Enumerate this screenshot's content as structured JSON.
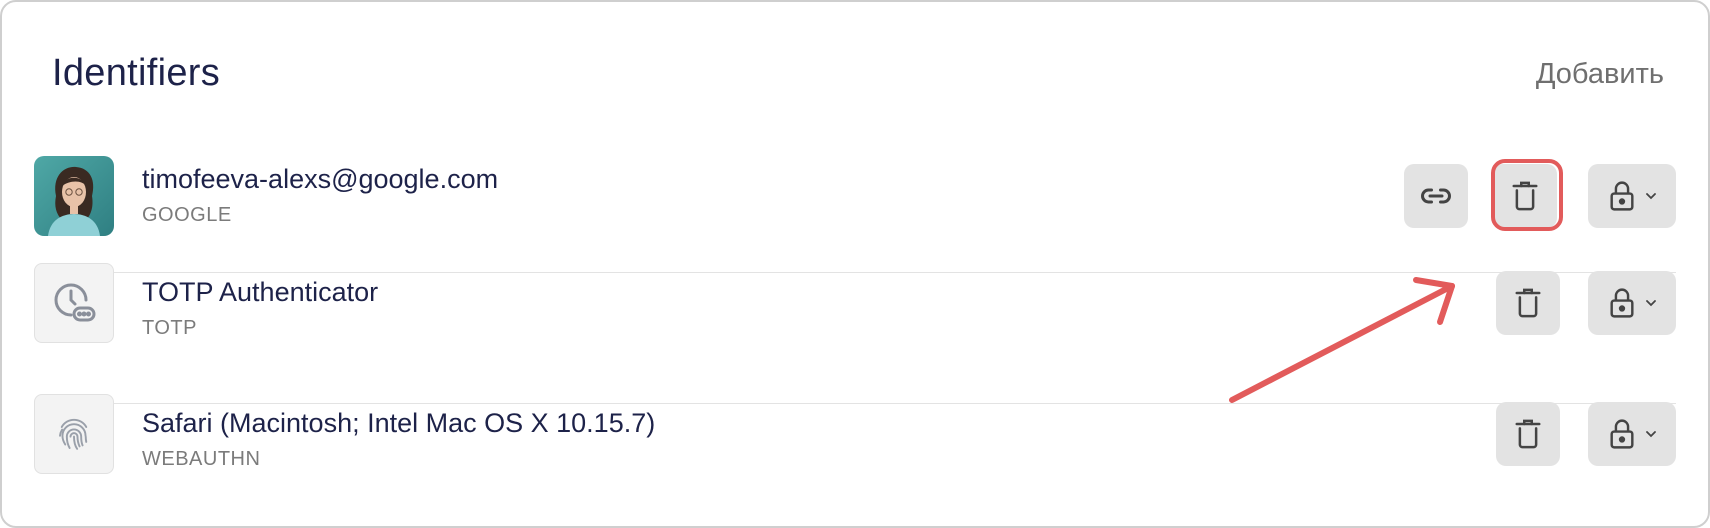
{
  "header": {
    "title": "Identifiers",
    "add_label": "Добавить"
  },
  "identifiers": [
    {
      "label": "timofeeva-alexs@google.com",
      "type": "GOOGLE",
      "icon": "user-avatar",
      "actions": [
        "link-icon",
        "trash-icon",
        "lock-icon"
      ]
    },
    {
      "label": "TOTP Authenticator",
      "type": "TOTP",
      "icon": "clock-password-icon",
      "actions": [
        "trash-icon",
        "lock-icon"
      ]
    },
    {
      "label": "Safari (Macintosh; Intel Mac OS X 10.15.7)",
      "type": "WEBAUTHN",
      "icon": "fingerprint-icon",
      "actions": [
        "trash-icon",
        "lock-icon"
      ]
    }
  ],
  "annotation": {
    "highlight_color": "#e25b5b",
    "highlighted_target": "delete-button (row 1)"
  },
  "colors": {
    "title": "#1d2249",
    "button_bg": "#e3e3e3",
    "icon": "#444444"
  }
}
